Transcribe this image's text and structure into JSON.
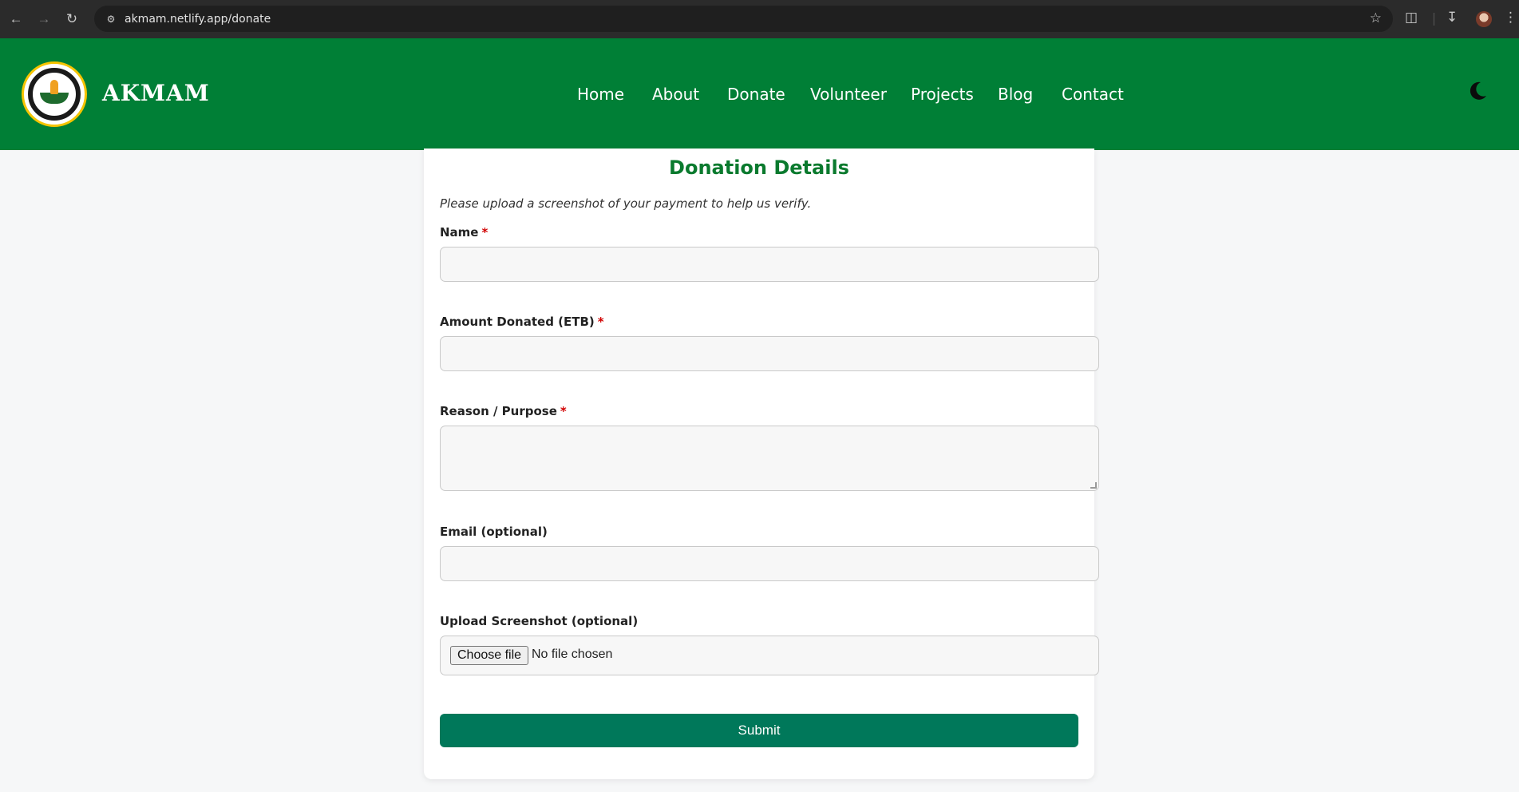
{
  "browser": {
    "url": "akmam.netlify.app/donate"
  },
  "header": {
    "brand": "AKMAM",
    "nav": [
      "Home",
      "About",
      "Donate",
      "Volunteer",
      "Projects",
      "Blog",
      "Contact"
    ]
  },
  "form": {
    "title": "Donation Details",
    "hint": "Please upload a screenshot of your payment to help us verify.",
    "required_mark": "*",
    "fields": [
      {
        "label": "Name",
        "required": true,
        "value": ""
      },
      {
        "label": "Amount Donated (ETB)",
        "required": true,
        "value": ""
      },
      {
        "label": "Reason / Purpose",
        "required": true,
        "value": ""
      },
      {
        "label": "Email (optional)",
        "required": false,
        "value": ""
      },
      {
        "label": "Upload Screenshot (optional)",
        "required": false
      }
    ],
    "file": {
      "button": "Choose file",
      "status": "No file chosen"
    },
    "submit": "Submit"
  },
  "colors": {
    "header_bg": "#007f36",
    "title_green": "#0a7a2e",
    "submit_bg": "#00785a",
    "required_red": "#d10000"
  }
}
